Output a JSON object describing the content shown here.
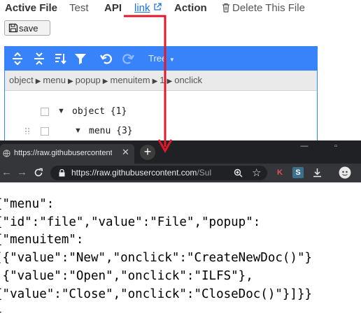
{
  "nav": {
    "active_file": "Active File",
    "test": "Test",
    "api": "API",
    "link": "link",
    "action": "Action",
    "delete_file": "Delete This File"
  },
  "save_button": {
    "label": "save"
  },
  "editor": {
    "mode_label": "Tree",
    "breadcrumb": [
      "object",
      "menu",
      "popup",
      "menuitem",
      "1",
      "onclick"
    ],
    "rows": [
      {
        "key": "object",
        "count": "{1}"
      },
      {
        "key": "menu",
        "count": "{3}"
      }
    ]
  },
  "browser": {
    "tab_title": "https://raw.githubusercontent.co",
    "url_host": "https://raw.githubusercontent.com",
    "url_tail": "/Sul...",
    "ext_k": "K",
    "ext_s": "S",
    "json_lines": [
      "{\"menu\":",
      "{\"id\":\"file\",\"value\":\"File\",\"popup\":",
      "{\"menuitem\":",
      "[{\"value\":\"New\",\"onclick\":\"CreateNewDoc()\"}",
      ",{\"value\":\"Open\",\"onclick\":\"ILFS\"},",
      "{\"value\":\"Close\",\"onclick\":\"CloseDoc()\"}]}}",
      "}"
    ]
  },
  "colors": {
    "editor_blue": "#3883fa",
    "annotation_red": "#e0192a",
    "browser_dark": "#202124"
  }
}
